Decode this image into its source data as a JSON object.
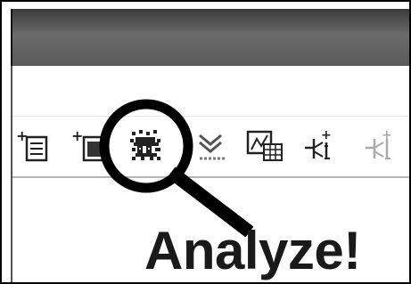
{
  "caption": {
    "text": "Analyze!"
  },
  "toolbar": {
    "buttons": [
      {
        "name": "add-table-button",
        "icon": "add-table-icon"
      },
      {
        "name": "add-document-button",
        "icon": "add-document-icon"
      },
      {
        "name": "analyze-button",
        "icon": "analyze-bug-icon",
        "highlighted": true
      },
      {
        "name": "merge-button",
        "icon": "merge-icon"
      },
      {
        "name": "chart-table-button",
        "icon": "chart-table-icon"
      },
      {
        "name": "branch-add-button",
        "icon": "branch-add-icon"
      },
      {
        "name": "branch-add-disabled-button",
        "icon": "branch-add-disabled-icon",
        "disabled": true
      }
    ]
  },
  "colors": {
    "titlebar": "#5a5a5a",
    "callout": "#000000",
    "caption": "#1a1a1a"
  }
}
